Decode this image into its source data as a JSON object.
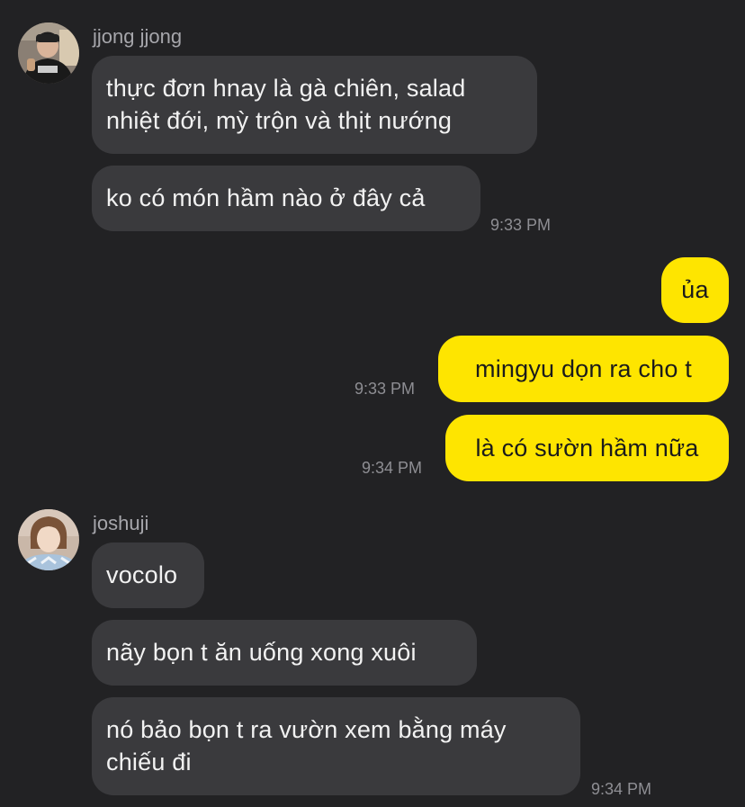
{
  "conversation": {
    "incoming_block_1": {
      "sender_name": "jjong jjong",
      "avatar_icon": "user-avatar-photo",
      "messages": [
        {
          "text": "thực đơn hnay là gà chiên, salad\nnhiệt đới, mỳ trộn và thịt nướng"
        },
        {
          "text": "ko có món hầm nào ở đây cả"
        }
      ],
      "timestamp": "9:33 PM"
    },
    "outgoing": {
      "messages": [
        {
          "text": "ủa"
        },
        {
          "text": "mingyu dọn ra cho t",
          "timestamp": "9:33 PM"
        },
        {
          "text": "là có sườn hầm nữa",
          "timestamp": "9:34 PM"
        }
      ]
    },
    "incoming_block_2": {
      "sender_name": "joshuji",
      "avatar_icon": "user-avatar-photo",
      "messages": [
        {
          "text": "vocolo"
        },
        {
          "text": "nãy bọn t ăn uống xong xuôi"
        },
        {
          "text": "nó bảo bọn t ra vườn xem bằng máy\nchiếu đi"
        }
      ],
      "timestamp": "9:34 PM"
    }
  },
  "colors": {
    "background": "#222224",
    "incoming_bubble": "#3a3a3d",
    "outgoing_bubble": "#fee500",
    "sender_name": "#a6a6ab",
    "timestamp": "#8e8e93"
  }
}
